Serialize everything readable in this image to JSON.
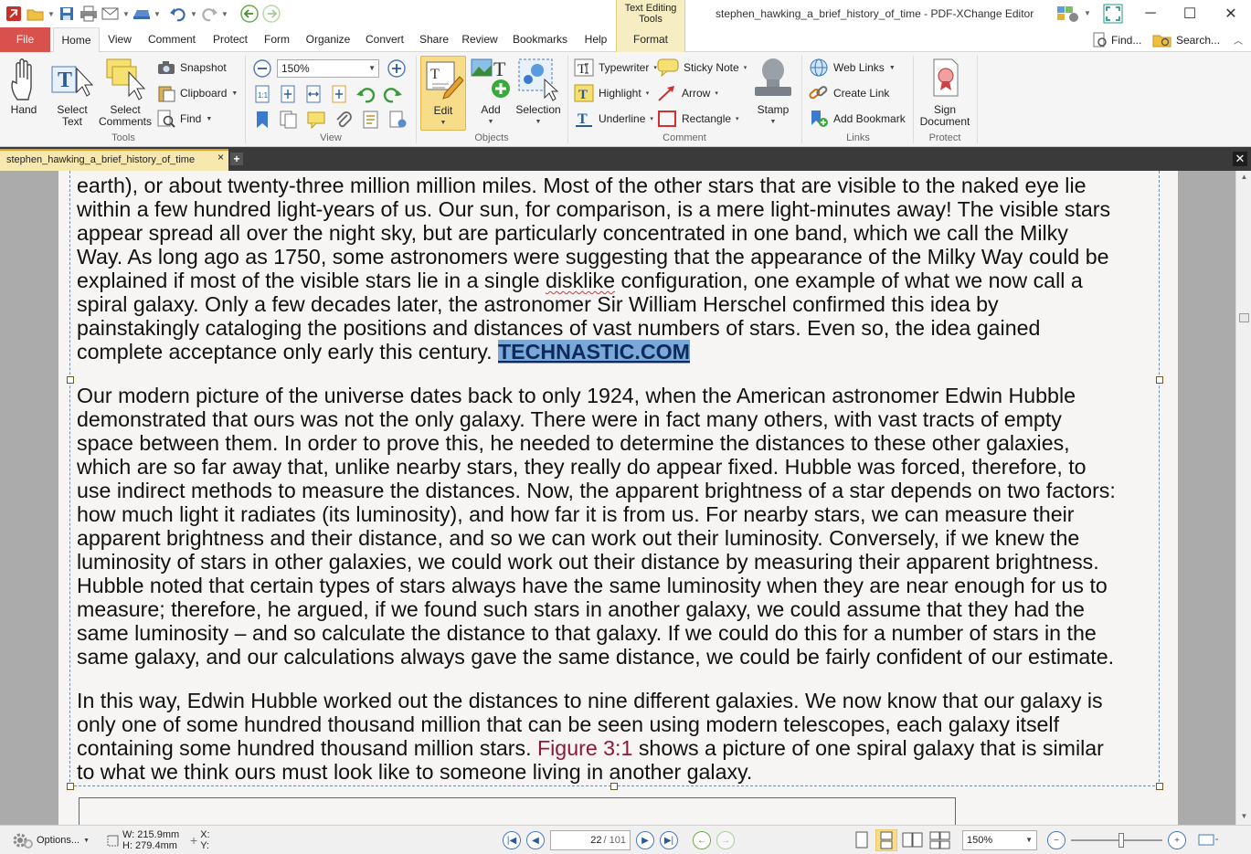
{
  "window": {
    "document_title": "stephen_hawking_a_brief_history_of_time - PDF-XChange Editor",
    "context_tab_group": "Text Editing Tools"
  },
  "tabs": [
    "File",
    "Home",
    "View",
    "Comment",
    "Protect",
    "Form",
    "Organize",
    "Convert",
    "Share",
    "Review",
    "Bookmarks",
    "Help",
    "Format"
  ],
  "active_tab": "Home",
  "right_tools": {
    "find": "Find...",
    "search": "Search..."
  },
  "ribbon": {
    "tools": {
      "hand": "Hand",
      "select_text": "Select Text",
      "select_comments": "Select Comments",
      "snapshot": "Snapshot",
      "clipboard": "Clipboard",
      "find": "Find",
      "group": "Tools"
    },
    "view": {
      "zoom": "150%",
      "group": "View"
    },
    "objects": {
      "edit": "Edit",
      "add": "Add",
      "selection": "Selection",
      "group": "Objects"
    },
    "comment": {
      "typewriter": "Typewriter",
      "sticky_note": "Sticky Note",
      "highlight": "Highlight",
      "arrow": "Arrow",
      "underline": "Underline",
      "rectangle": "Rectangle",
      "stamp": "Stamp",
      "group": "Comment"
    },
    "links": {
      "web_links": "Web Links",
      "create_link": "Create Link",
      "add_bookmark": "Add Bookmark",
      "group": "Links"
    },
    "protect": {
      "sign_document": "Sign Document",
      "group": "Protect"
    }
  },
  "doc_tab": "stephen_hawking_a_brief_history_of_time",
  "document": {
    "para1": [
      "earth), or about twenty-three million million miles. Most of the other stars that are visible to the naked eye lie",
      "within a few hundred light-years of us. Our sun, for comparison, is a mere light-minutes away! The visible stars",
      "appear spread all over the night sky, but are particularly concentrated in one band, which we call the Milky",
      "Way. As long ago as 1750, some astronomers were suggesting that the appearance of the Milky Way could be",
      "explained if most of the visible stars lie in a single ",
      "disklike",
      " configuration, one example of what we now call a",
      "spiral galaxy. Only a few decades later, the astronomer Sir William Herschel confirmed this idea by",
      "painstakingly cataloging the positions and distances of vast numbers of stars. Even so, the idea gained",
      "complete acceptance only early this century. ",
      "TECHNASTIC.COM"
    ],
    "para2": [
      "Our modern picture of the universe dates back to only 1924, when the American astronomer Edwin Hubble",
      "demonstrated that ours was not the only galaxy. There were in fact many others, with vast tracts of empty",
      "space between them. In order to prove this, he needed to determine the distances to these other galaxies,",
      "which are so far away that, unlike nearby stars, they really do appear fixed. Hubble was forced, therefore, to",
      "use indirect methods to measure the distances. Now, the apparent brightness of a star depends on two factors:",
      "how much light it radiates (its luminosity), and how far it is from us. For nearby stars, we can measure their",
      "apparent brightness and their distance, and so we can work out their luminosity. Conversely, if we knew the",
      "luminosity of stars in other galaxies, we could work out their distance by measuring their apparent brightness.",
      "Hubble noted that certain types of stars always have the same luminosity when they are near enough for us to",
      "measure; therefore, he argued, if we found such stars in another galaxy, we could assume that they had the",
      "same luminosity – and so calculate the distance to that galaxy. If we could do this for a number of stars in the",
      "same galaxy, and our calculations always gave the same distance, we could be fairly confident of our estimate."
    ],
    "para3": [
      "In this way, Edwin Hubble worked out the distances to nine different galaxies. We now know that our galaxy is",
      "only one of some hundred thousand million that can be seen using modern telescopes, each galaxy itself",
      "containing some hundred thousand million stars. ",
      "Figure 3:1",
      " shows a picture of one spiral galaxy that is similar",
      "to what we think ours must look like to someone living in another galaxy."
    ]
  },
  "statusbar": {
    "options": "Options...",
    "width": "W: 215.9mm",
    "height": "H: 279.4mm",
    "x": "X:",
    "y": "Y:",
    "current_page": "22",
    "total_pages": "/ 101",
    "zoom": "150%"
  },
  "colors": {
    "file_tab": "#d8514d",
    "context_tab": "#f7edc2",
    "selection": "#7aa8d8",
    "figure_link": "#8a1a38"
  }
}
